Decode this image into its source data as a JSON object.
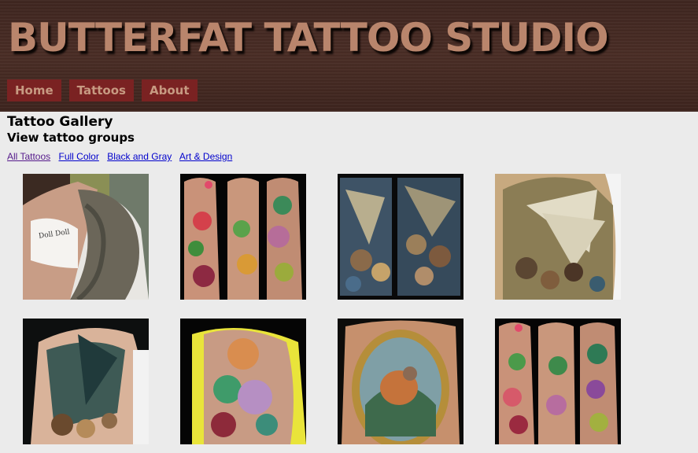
{
  "site": {
    "title": "BUTTERFAT TATTOO STUDIO"
  },
  "nav": [
    "Home",
    "Tattoos",
    "About"
  ],
  "page": {
    "title": "Tattoo Gallery",
    "subtitle": "View tattoo groups"
  },
  "filters": [
    "All Tattoos",
    "Full Color",
    "Black and Gray",
    "Art & Design"
  ],
  "gallery": {
    "thumbs": [
      {
        "name": "sleeve-portrait-tattoo",
        "shirt_text": "Doll Doll"
      },
      {
        "name": "floral-sleeve-tattoo"
      },
      {
        "name": "ship-crowd-tattoo"
      },
      {
        "name": "ship-sails-tattoo"
      },
      {
        "name": "ship-shoulder-tattoo"
      },
      {
        "name": "flower-shoulder-tattoo"
      },
      {
        "name": "bird-cameo-tattoo"
      },
      {
        "name": "floral-sleeve-tattoo-2"
      }
    ]
  },
  "colors": {
    "header_bg": "#452a23",
    "title": "#b9856c",
    "nav_bg": "#7a2222",
    "nav_text": "#c79a82",
    "link": "#0000cc",
    "visited": "#551a8b",
    "page_bg": "#ebebeb"
  }
}
